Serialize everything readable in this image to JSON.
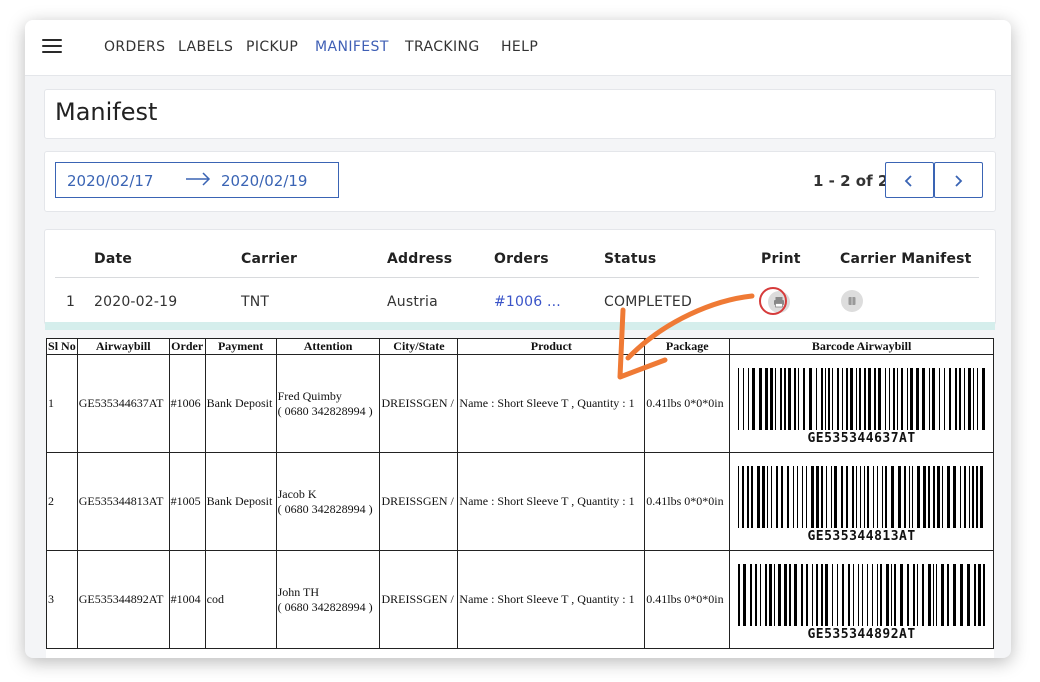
{
  "nav": {
    "items": [
      "ORDERS",
      "LABELS",
      "PICKUP",
      "MANIFEST",
      "TRACKING",
      "HELP"
    ],
    "active": "MANIFEST"
  },
  "page": {
    "title": "Manifest"
  },
  "filter": {
    "date_from": "2020/02/17",
    "date_to": "2020/02/19",
    "pager_text": "1 - 2 of 2"
  },
  "list": {
    "headers": [
      "Date",
      "Carrier",
      "Address",
      "Orders",
      "Status",
      "Print",
      "Carrier Manifest"
    ],
    "rows": [
      {
        "index": "1",
        "date": "2020-02-19",
        "carrier": "TNT",
        "address": "Austria",
        "orders": "#1006 ...",
        "status": "COMPLETED"
      }
    ]
  },
  "manifest": {
    "headers": [
      "Sl No",
      "Airwaybill",
      "Order",
      "Payment",
      "Attention",
      "City/State",
      "Product",
      "Package",
      "Barcode Airwaybill"
    ],
    "rows": [
      {
        "sl": "1",
        "awb": "GE535344637AT",
        "order": "#1006",
        "payment": "Bank Deposit",
        "name": "Fred Quimby",
        "phone": "( 0680 342828994 )",
        "city": "DREISSGEN /",
        "product": "Name : Short Sleeve T , Quantity : 1",
        "package": "0.41lbs 0*0*0in",
        "barcode": "GE535344637AT"
      },
      {
        "sl": "2",
        "awb": "GE535344813AT",
        "order": "#1005",
        "payment": "Bank Deposit",
        "name": "Jacob K",
        "phone": "( 0680 342828994 )",
        "city": "DREISSGEN /",
        "product": "Name : Short Sleeve T , Quantity : 1",
        "package": "0.41lbs 0*0*0in",
        "barcode": "GE535344813AT"
      },
      {
        "sl": "3",
        "awb": "GE535344892AT",
        "order": "#1004",
        "payment": "cod",
        "name": "John TH",
        "phone": "( 0680 342828994 )",
        "city": "DREISSGEN /",
        "product": "Name : Short Sleeve T , Quantity : 1",
        "package": "0.41lbs 0*0*0in",
        "barcode": "GE535344892AT"
      }
    ]
  },
  "icons": {
    "menu": "hamburger-icon",
    "arrow": "arrow-right-icon",
    "prev": "chevron-left-icon",
    "next": "chevron-right-icon",
    "print": "printer-icon",
    "carrier_manifest": "document-icon"
  },
  "colors": {
    "accent": "#3a64b4",
    "active_nav": "#3f5fb5",
    "link": "#3a54c8",
    "highlight_circle": "#d63b3b",
    "annotation_arrow": "#ef7a35",
    "teal_strip": "#d5eeec"
  }
}
